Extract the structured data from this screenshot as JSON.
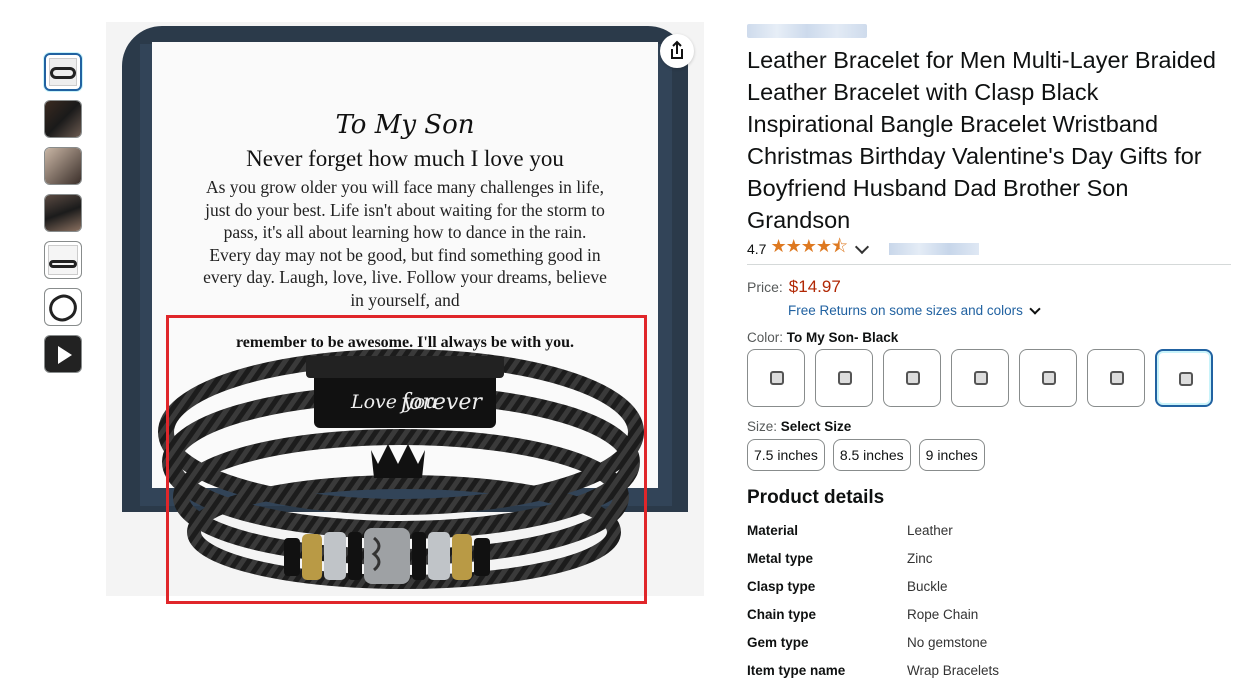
{
  "card": {
    "title": "To My Son",
    "headline": "Never forget how much I love you",
    "body": "As you grow older you will face many challenges in life, just do your best. Life isn't about waiting for the storm to pass, it's all about learning how to dance in the rain. Every day may not be good, but find something good in every day. Laugh, love, live. Follow your dreams, believe in yourself, and",
    "last_line": "remember to be awesome. I'll always be with you.",
    "clasp_left": "Love you",
    "clasp_right": "forever"
  },
  "product": {
    "title": "Leather Bracelet for Men Multi-Layer Braided Leather Bracelet with Clasp Black Inspirational Bangle Bracelet Wristband Christmas Birthday Valentine's Day Gifts for Boyfriend Husband Dad Brother Son Grandson",
    "rating": "4.7",
    "stars": "★★★★⯪",
    "price_label": "Price:",
    "price": "$14.97",
    "free_returns": "Free Returns on some sizes and colors",
    "color_label": "Color:",
    "color_value": "To My Son- Black",
    "size_label": "Size:",
    "size_value": "Select Size",
    "sizes": [
      "7.5 inches",
      "8.5 inches",
      "9 inches"
    ]
  },
  "details": {
    "heading": "Product details",
    "rows": [
      {
        "key": "Material",
        "value": "Leather"
      },
      {
        "key": "Metal type",
        "value": "Zinc"
      },
      {
        "key": "Clasp type",
        "value": "Buckle"
      },
      {
        "key": "Chain type",
        "value": "Rope Chain"
      },
      {
        "key": "Gem type",
        "value": "No gemstone"
      },
      {
        "key": "Item type name",
        "value": "Wrap Bracelets"
      }
    ]
  },
  "colors": {
    "accent": "#2162a1",
    "price": "#b12704",
    "star": "#de7921",
    "highlight": "#e0262a"
  }
}
